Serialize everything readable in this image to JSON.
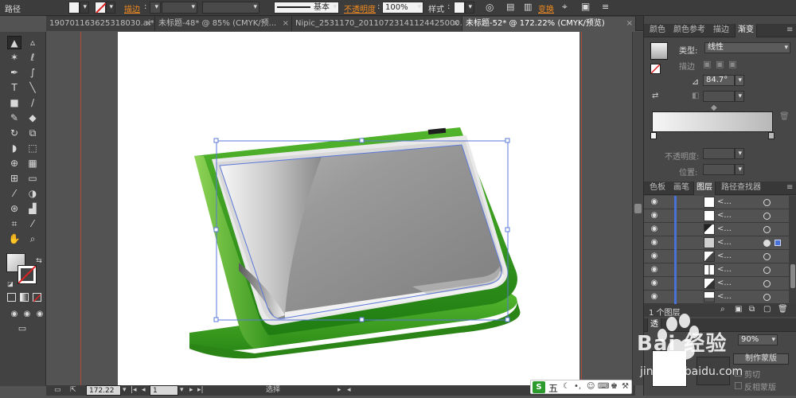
{
  "control_bar": {
    "path_label": "路径",
    "stroke_label": "描边",
    "stroke_style": "基本",
    "opacity_label": "不透明度",
    "opacity_value": "100%",
    "style_label": "样式",
    "transform_label": "变换"
  },
  "tabs": [
    {
      "label": "190701163625318030.ai*",
      "close": "×"
    },
    {
      "label": "未标题-48* @ 85% (CMYK/预...",
      "close": "×"
    },
    {
      "label": "Nipic_2531170_20110723141124425000.ai*",
      "close": "×"
    },
    {
      "label": "未标题-52* @ 172.22% (CMYK/预览)",
      "close": "×"
    }
  ],
  "panels": {
    "top_tabs": [
      "颜色",
      "颜色参考",
      "描边",
      "渐变"
    ],
    "gradient": {
      "type_label": "类型:",
      "type_value": "线性",
      "stroke_label": "描边",
      "angle_value": "84.7°",
      "opacity_label": "不透明度:",
      "position_label": "位置:"
    },
    "layer_tabs": [
      "色板",
      "画笔",
      "图层",
      "路径查找器"
    ],
    "layer_rows": [
      {
        "name": "<..."
      },
      {
        "name": "<..."
      },
      {
        "name": "<..."
      },
      {
        "name": "<..."
      },
      {
        "name": "<..."
      },
      {
        "name": "<..."
      },
      {
        "name": "<..."
      },
      {
        "name": "<..."
      }
    ],
    "layer_count": "1 个图层",
    "transparency": {
      "tab_label": "透",
      "opacity_value": "90%",
      "make_mask": "制作蒙版",
      "clip": "剪切",
      "invert": "反相蒙版"
    }
  },
  "status": {
    "zoom": "172.22",
    "page": "1",
    "tool": "选择"
  },
  "ime": {
    "char": "五"
  },
  "watermark": {
    "text": "Bai 经验",
    "site": "jingyan.baidu.com"
  },
  "colors": {
    "green_dark": "#2e8a18",
    "green_light": "#6ec23a",
    "selection_blue": "#5a78d8",
    "accent_orange": "#f28c1e"
  }
}
